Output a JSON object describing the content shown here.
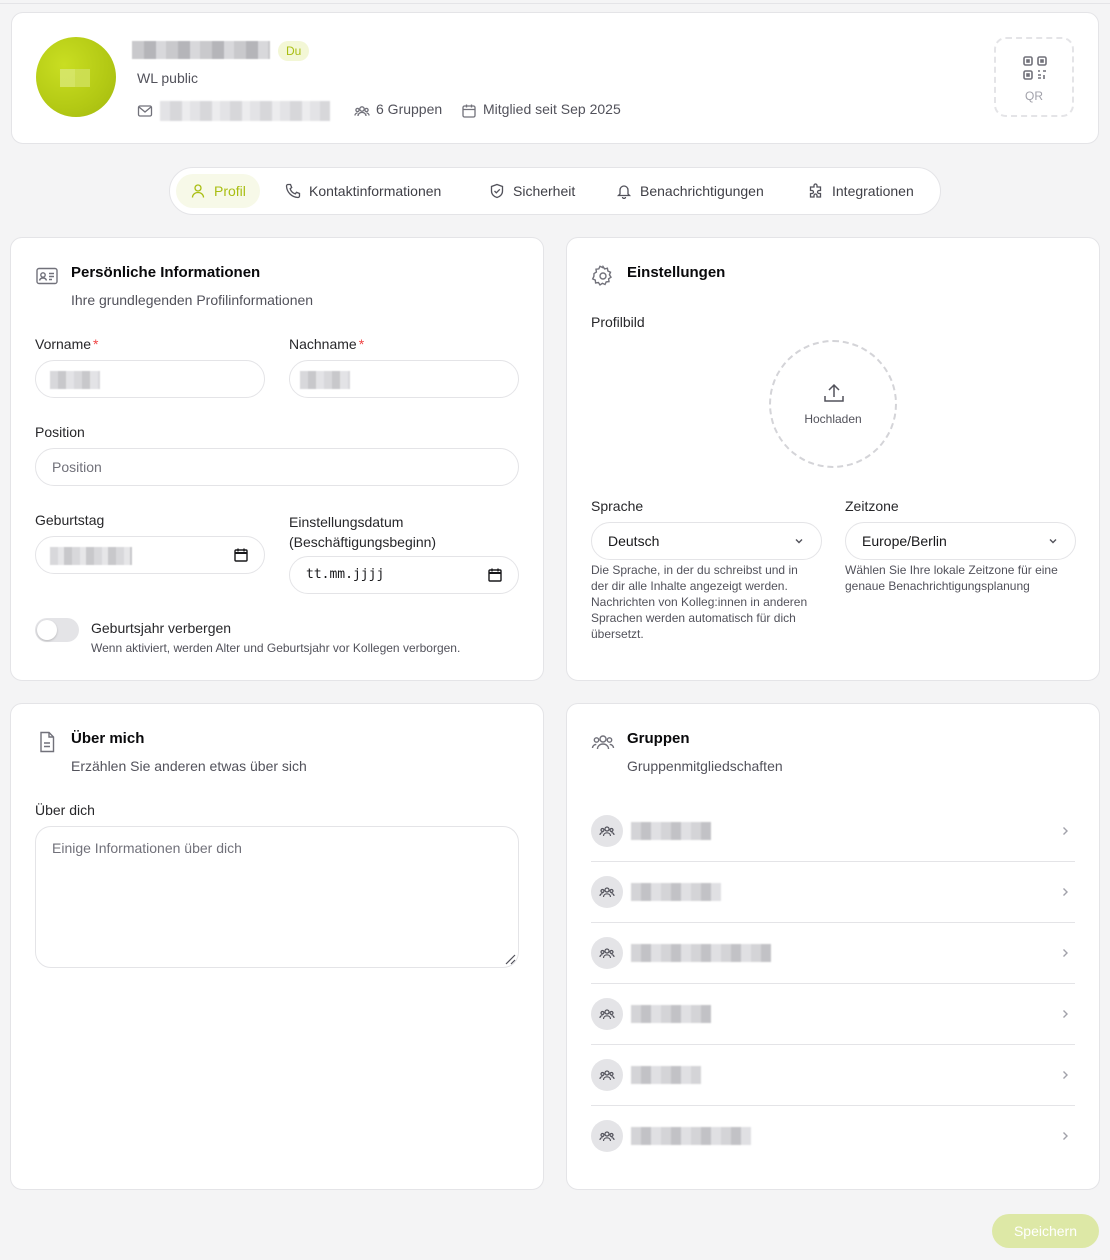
{
  "header": {
    "you_badge": "Du",
    "organization": "WL public",
    "groups_count": "6 Gruppen",
    "member_since": "Mitglied seit Sep 2025",
    "qr_label": "QR"
  },
  "tabs": [
    {
      "label": "Profil",
      "icon": "user-icon",
      "active": true
    },
    {
      "label": "Kontaktinformationen",
      "icon": "phone-icon",
      "active": false
    },
    {
      "label": "Sicherheit",
      "icon": "shield-icon",
      "active": false
    },
    {
      "label": "Benachrichtigungen",
      "icon": "bell-icon",
      "active": false
    },
    {
      "label": "Integrationen",
      "icon": "puzzle-icon",
      "active": false
    }
  ],
  "personal": {
    "title": "Persönliche Informationen",
    "subtitle": "Ihre grundlegenden Profilinformationen",
    "first_name_label": "Vorname",
    "last_name_label": "Nachname",
    "required_mark": "*",
    "position_label": "Position",
    "position_placeholder": "Position",
    "birthday_label": "Geburtstag",
    "hire_date_label_1": "Einstellungsdatum",
    "hire_date_label_2": "(Beschäftigungsbeginn)",
    "hire_date_placeholder": "tt.mm.jjjj",
    "hide_year_label": "Geburtsjahr verbergen",
    "hide_year_help": "Wenn aktiviert, werden Alter und Geburtsjahr vor Kollegen verborgen.",
    "hide_year_enabled": false
  },
  "settings": {
    "title": "Einstellungen",
    "profile_picture_label": "Profilbild",
    "upload_label": "Hochladen",
    "language_label": "Sprache",
    "language_value": "Deutsch",
    "language_help": [
      "Die Sprache, in der du schreibst und in",
      "der dir alle Inhalte angezeigt werden.",
      "Nachrichten von Kolleg:innen in anderen",
      "Sprachen werden automatisch für dich",
      "übersetzt."
    ],
    "timezone_label": "Zeitzone",
    "timezone_value": "Europe/Berlin",
    "timezone_help": [
      "Wählen Sie Ihre lokale Zeitzone für eine",
      "genaue Benachrichtigungsplanung"
    ]
  },
  "about": {
    "title": "Über mich",
    "subtitle": "Erzählen Sie anderen etwas über sich",
    "field_label": "Über dich",
    "placeholder": "Einige Informationen über dich"
  },
  "groups": {
    "title": "Gruppen",
    "subtitle": "Gruppenmitgliedschaften",
    "count": 6
  },
  "actions": {
    "save_label": "Speichern"
  },
  "colors": {
    "accent": "#a9be12",
    "accent_light": "#f7f9e8",
    "save_disabled": "#dde8a6",
    "required": "#ef4444"
  }
}
